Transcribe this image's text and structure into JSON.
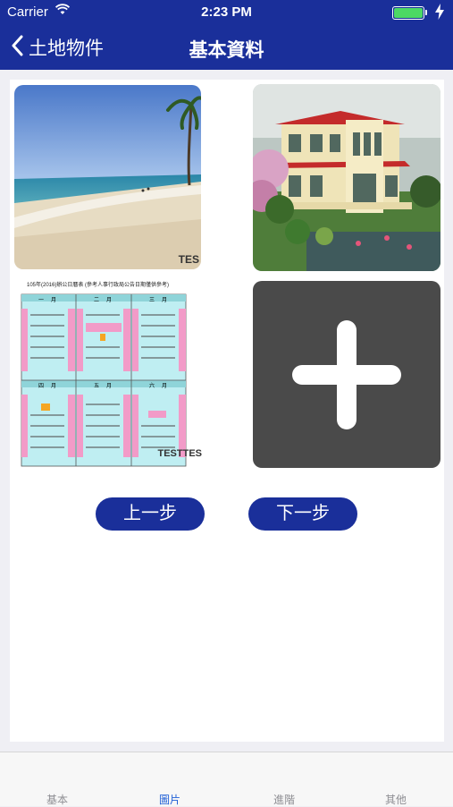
{
  "status_bar": {
    "carrier": "Carrier",
    "time": "2:23 PM",
    "battery_color": "#4cd964"
  },
  "nav": {
    "back_label": "土地物件",
    "title": "基本資料",
    "bar_color": "#1a2f9a"
  },
  "photos": [
    {
      "name": "beach-photo",
      "content": "beach scene",
      "watermark": "TES"
    },
    {
      "name": "house-photo",
      "content": "villa with garden"
    },
    {
      "name": "calendar-photo",
      "content": "calendar sheet",
      "header": "105年(2016)辦公日曆表 (參考人事行政局公告日期僅供參考)",
      "months": [
        "一月",
        "二月",
        "三月",
        "四月",
        "五月",
        "六月"
      ],
      "watermark": "TESTTES"
    },
    {
      "name": "add-photo",
      "content": "add-icon"
    }
  ],
  "buttons": {
    "prev": "上一步",
    "next": "下一步"
  },
  "tabs": [
    {
      "label": "基本",
      "active": false
    },
    {
      "label": "圖片",
      "active": true
    },
    {
      "label": "進階",
      "active": false
    },
    {
      "label": "其他",
      "active": false
    }
  ]
}
